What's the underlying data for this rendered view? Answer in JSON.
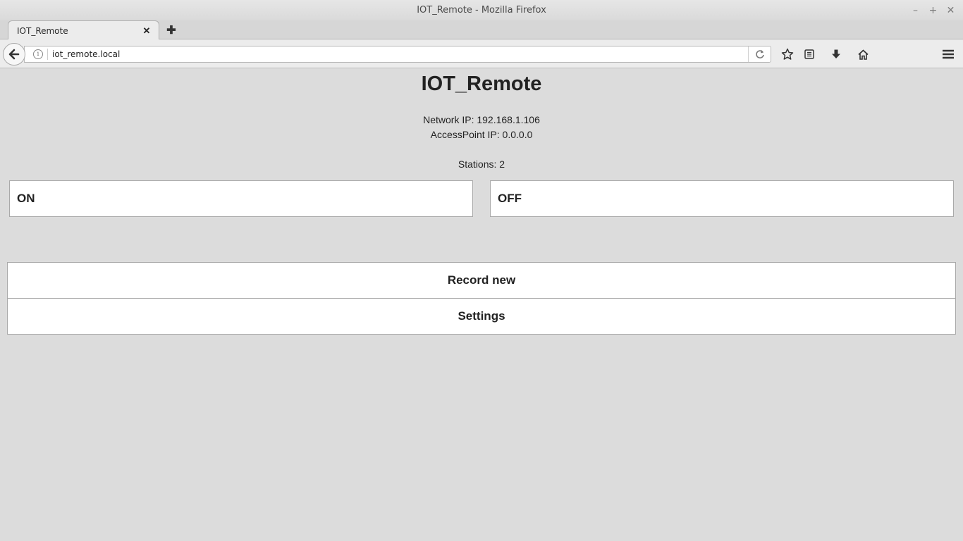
{
  "window": {
    "title": "IOT_Remote - Mozilla Firefox",
    "controls": {
      "minimize": "–",
      "maximize": "+",
      "close": "✕"
    }
  },
  "browser": {
    "tab_label": "IOT_Remote",
    "tab_close": "✕",
    "new_tab": "✚",
    "url": "iot_remote.local",
    "info_glyph": "i"
  },
  "page": {
    "heading": "IOT_Remote",
    "network_ip": "Network IP: 192.168.1.106",
    "accesspoint_ip": "AccessPoint IP: 0.0.0.0",
    "stations": "Stations: 2",
    "buttons": {
      "on": "ON",
      "off": "OFF",
      "record_new": "Record new",
      "settings": "Settings"
    }
  },
  "icons": {
    "back": "back-arrow-icon",
    "info": "info-icon",
    "reload": "reload-icon",
    "bookmark": "star-icon",
    "reading_list": "reading-list-icon",
    "downloads": "download-arrow-icon",
    "home": "home-icon",
    "menu": "hamburger-menu-icon"
  }
}
